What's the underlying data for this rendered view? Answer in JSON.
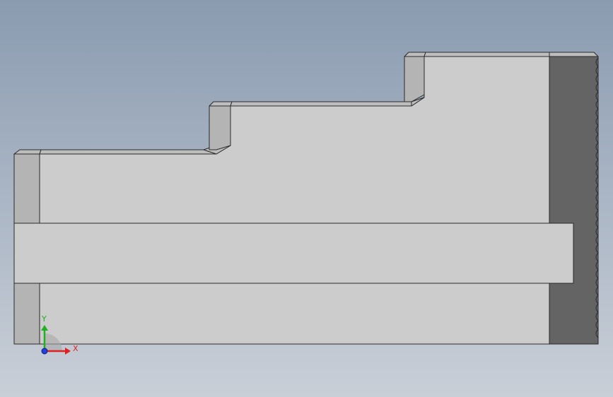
{
  "viewport": {
    "background_top": "#8a9bb0",
    "background_bottom": "#c9cfd7"
  },
  "part": {
    "face_color": "#cccccc",
    "edge_color": "#2a2a2a",
    "side_face_color": "#b4b4b4",
    "top_face_color": "#bdbdbd",
    "serrated_face_color": "#646464"
  },
  "triad": {
    "x_label": "X",
    "y_label": "Y",
    "x_color": "#e02020",
    "y_color": "#20b020",
    "z_color": "#2040e0"
  }
}
